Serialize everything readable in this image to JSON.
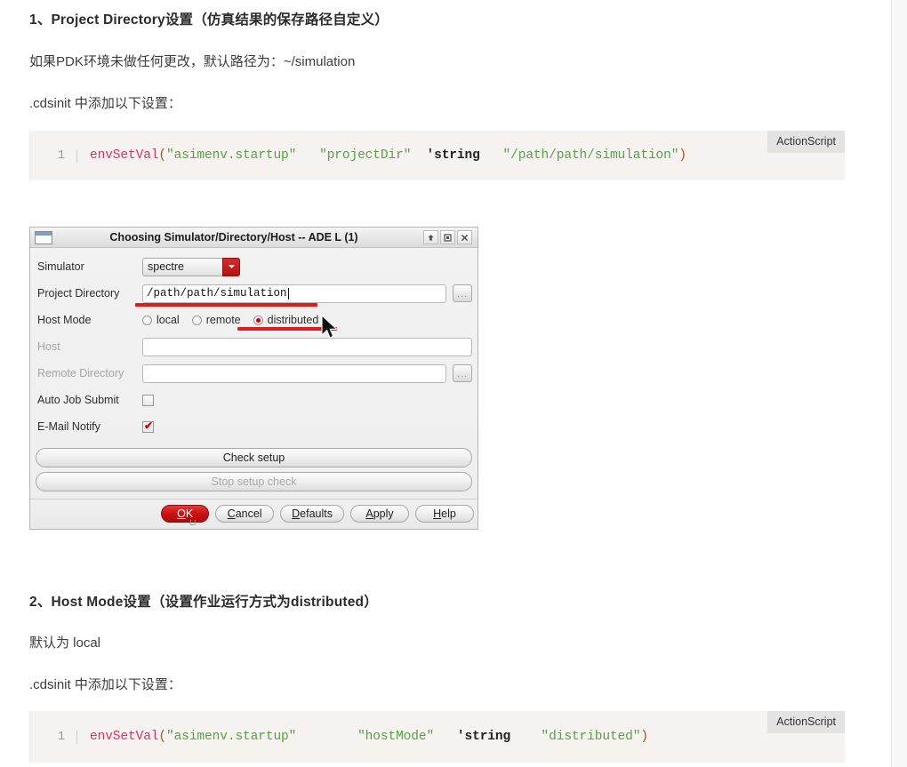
{
  "page": {
    "section1_heading": "1、Project Directory设置（仿真结果的保存路径自定义）",
    "section1_para1": "如果PDK环境未做任何更改，默认路径为：~/simulation",
    "section1_para2": ".cdsinit 中添加以下设置：",
    "section2_heading": "2、Host Mode设置（设置作业运行方式为distributed）",
    "section2_para1": "默认为 local",
    "section2_para2": ".cdsinit 中添加以下设置："
  },
  "code_blocks": [
    {
      "lang_badge": "ActionScript",
      "line_number": "1",
      "tokens": [
        {
          "t": "envSetVal",
          "c": "fn"
        },
        {
          "t": "(",
          "c": "punc"
        },
        {
          "t": "\"asimenv.startup\"",
          "c": "str"
        },
        {
          "t": "   ",
          "c": "plain"
        },
        {
          "t": "\"projectDir\"",
          "c": "str"
        },
        {
          "t": "  ",
          "c": "plain"
        },
        {
          "t": "'string",
          "c": "kw"
        },
        {
          "t": "   ",
          "c": "plain"
        },
        {
          "t": "\"/path/path/simulation\"",
          "c": "str"
        },
        {
          "t": ")",
          "c": "punc"
        }
      ],
      "plain": "envSetVal(\"asimenv.startup\"   \"projectDir\"  'string   \"/path/path/simulation\")"
    },
    {
      "lang_badge": "ActionScript",
      "line_number": "1",
      "tokens": [
        {
          "t": "envSetVal",
          "c": "fn"
        },
        {
          "t": "(",
          "c": "punc"
        },
        {
          "t": "\"asimenv.startup\"",
          "c": "str"
        },
        {
          "t": "        ",
          "c": "plain"
        },
        {
          "t": "\"hostMode\"",
          "c": "str"
        },
        {
          "t": "   ",
          "c": "plain"
        },
        {
          "t": "'string",
          "c": "kw"
        },
        {
          "t": "    ",
          "c": "plain"
        },
        {
          "t": "\"distributed\"",
          "c": "str"
        },
        {
          "t": ")",
          "c": "punc"
        }
      ],
      "plain": "envSetVal(\"asimenv.startup\"        \"hostMode\"   'string    \"distributed\")"
    }
  ],
  "dialog": {
    "title": "Choosing Simulator/Directory/Host -- ADE L (1)",
    "titlebar_buttons": [
      {
        "name": "shade-icon",
        "glyph": "⇧"
      },
      {
        "name": "maximize-icon",
        "glyph": "❐"
      },
      {
        "name": "close-icon",
        "glyph": "✕"
      }
    ],
    "fields": {
      "simulator_label": "Simulator",
      "simulator_value": "spectre",
      "simulator_options": [
        "spectre"
      ],
      "project_directory_label": "Project Directory",
      "project_directory_value": "/path/path/simulation",
      "host_mode_label": "Host Mode",
      "host_mode_options": [
        {
          "label": "local",
          "selected": false
        },
        {
          "label": "remote",
          "selected": false
        },
        {
          "label": "distributed",
          "selected": true
        }
      ],
      "host_label": "Host",
      "host_value": "",
      "remote_directory_label": "Remote Directory",
      "remote_directory_value": "",
      "auto_job_submit_label": "Auto Job Submit",
      "auto_job_submit_checked": false,
      "email_notify_label": "E-Mail Notify",
      "email_notify_checked": true,
      "browse_label": "..."
    },
    "actions": {
      "check_setup": "Check setup",
      "stop_setup_check": "Stop setup check",
      "ok": "OK",
      "cancel": "Cancel",
      "defaults": "Defaults",
      "apply": "Apply",
      "help": "Help"
    }
  },
  "colors": {
    "accent_red": "#cc0000",
    "annotation_red": "#e01b1b",
    "code_bg": "#f6f2f0",
    "badge_bg": "#e3e3e3",
    "dialog_bg": "#efefef"
  }
}
